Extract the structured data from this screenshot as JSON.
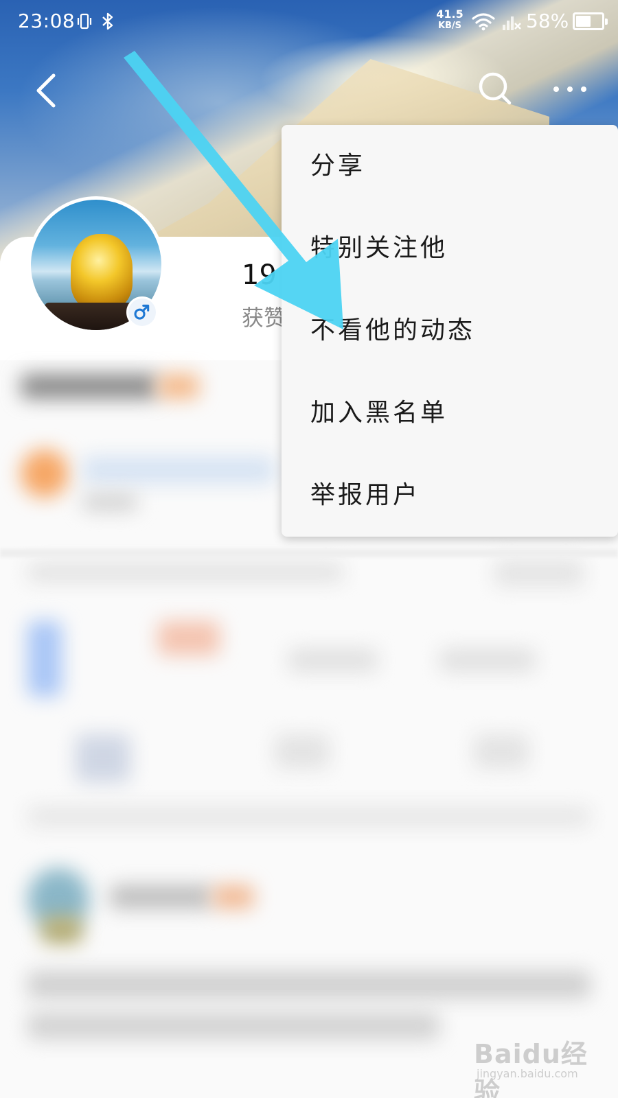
{
  "status_bar": {
    "time": "23:08",
    "net_speed_value": "41.5",
    "net_speed_unit": "KB/S",
    "battery_percent": "58%",
    "battery_level": 0.58
  },
  "nav": {
    "back_icon": "chevron-left-icon",
    "search_icon": "search-icon",
    "more_icon": "more-horizontal-icon"
  },
  "profile": {
    "username_partial": "19",
    "likes_label_partial": "获赞",
    "gender": "male"
  },
  "menu": {
    "items": [
      {
        "label": "分享"
      },
      {
        "label": "特别关注他"
      },
      {
        "label": "不看他的动态"
      },
      {
        "label": "加入黑名单"
      },
      {
        "label": "举报用户"
      }
    ]
  },
  "annotation": {
    "arrow_color": "#4cd3f2",
    "target": "不看他的动态"
  },
  "watermark": {
    "logo": "Baidu经验",
    "url": "jingyan.baidu.com"
  },
  "colors": {
    "banner_sky": "#2a62b3",
    "badge_blue": "#1e78d4",
    "menu_bg": "#f7f7f7"
  }
}
